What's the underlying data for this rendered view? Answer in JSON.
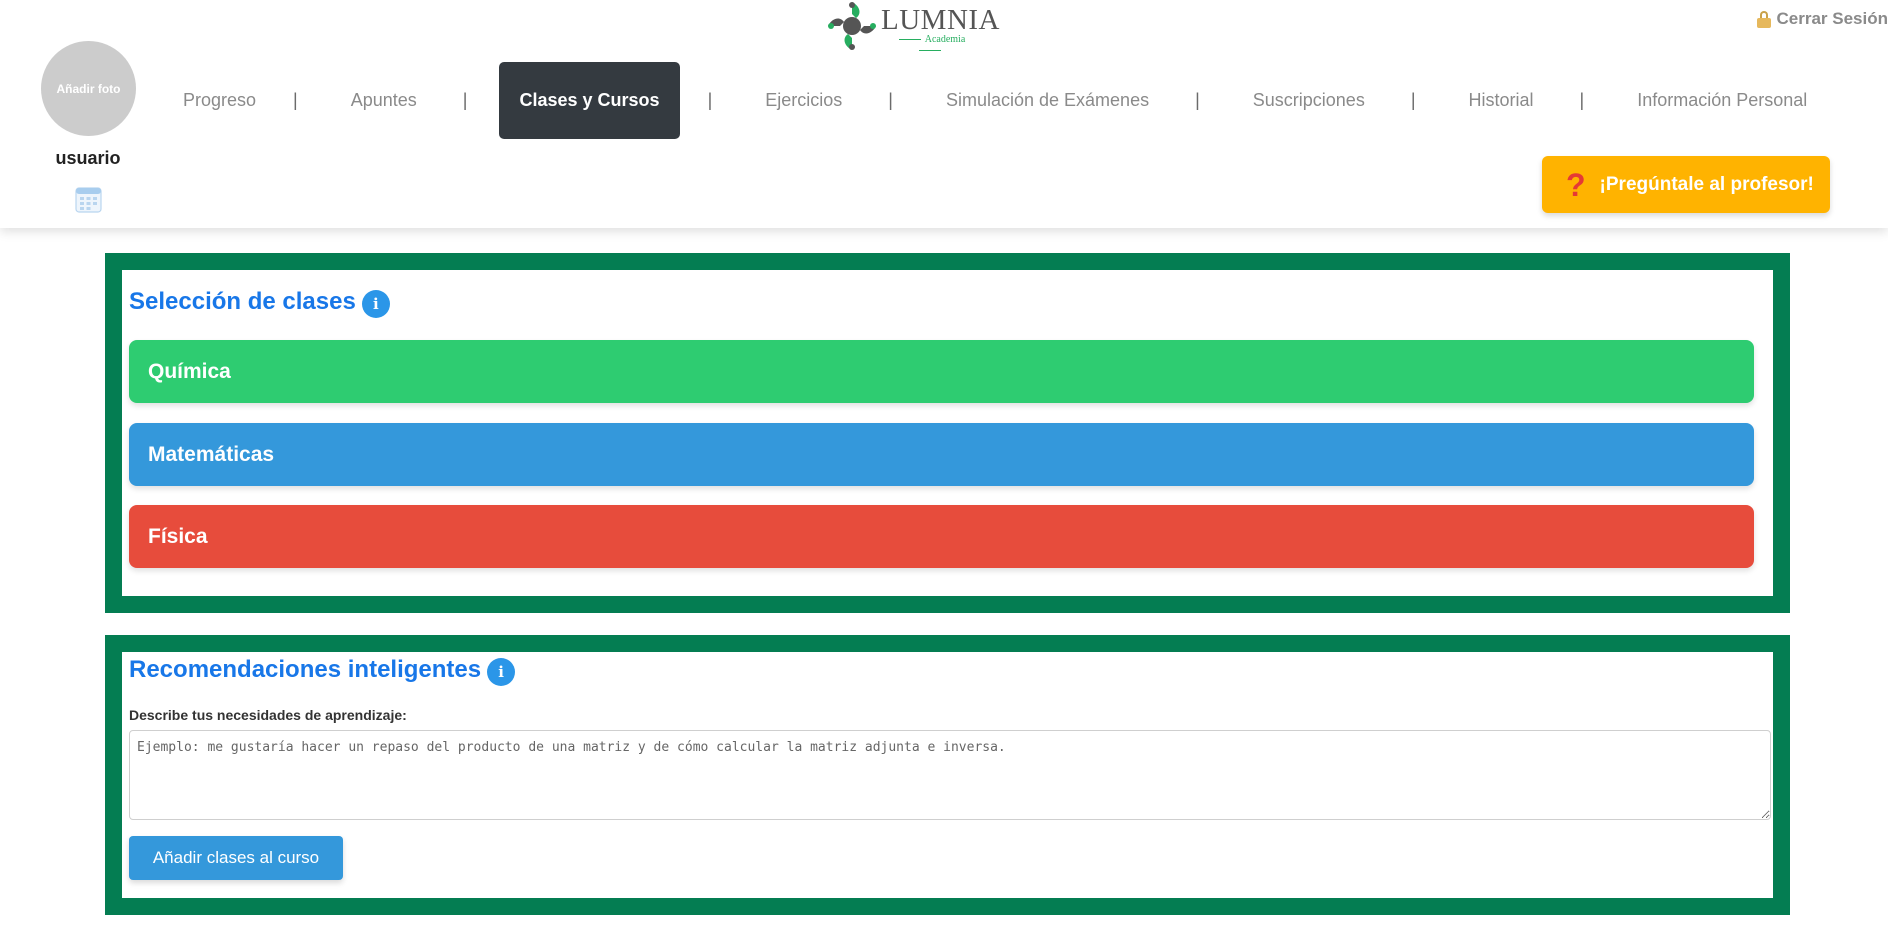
{
  "brand": {
    "name": "LUMNIA",
    "subtitle": "Academia"
  },
  "header": {
    "logout_label": "Cerrar Sesión",
    "avatar_label": "Añadir foto",
    "username": "usuario",
    "ask_button": "¡Pregúntale al profesor!"
  },
  "nav": {
    "items": [
      {
        "label": "Progreso"
      },
      {
        "label": "Apuntes"
      },
      {
        "label": "Clases y Cursos",
        "active": true
      },
      {
        "label": "Ejercicios"
      },
      {
        "label": "Simulación de Exámenes"
      },
      {
        "label": "Suscripciones"
      },
      {
        "label": "Historial"
      },
      {
        "label": "Información Personal"
      }
    ],
    "separator": "|"
  },
  "class_selection": {
    "title": "Selección de clases",
    "info_icon": "i",
    "classes": [
      {
        "label": "Química",
        "color": "#2ecc71"
      },
      {
        "label": "Matemáticas",
        "color": "#3498db"
      },
      {
        "label": "Física",
        "color": "#e74c3c"
      }
    ]
  },
  "recommendations": {
    "title": "Recomendaciones inteligentes",
    "info_icon": "i",
    "field_label": "Describe tus necesidades de aprendizaje:",
    "placeholder": "Ejemplo: me gustaría hacer un repaso del producto de una matriz y de cómo calcular la matriz adjunta e inversa.",
    "value": "",
    "submit_label": "Añadir clases al curso"
  },
  "colors": {
    "panel_border": "#047d52",
    "accent_blue": "#1877e8",
    "nav_active": "#343a40",
    "ask_button": "#ffb300"
  }
}
